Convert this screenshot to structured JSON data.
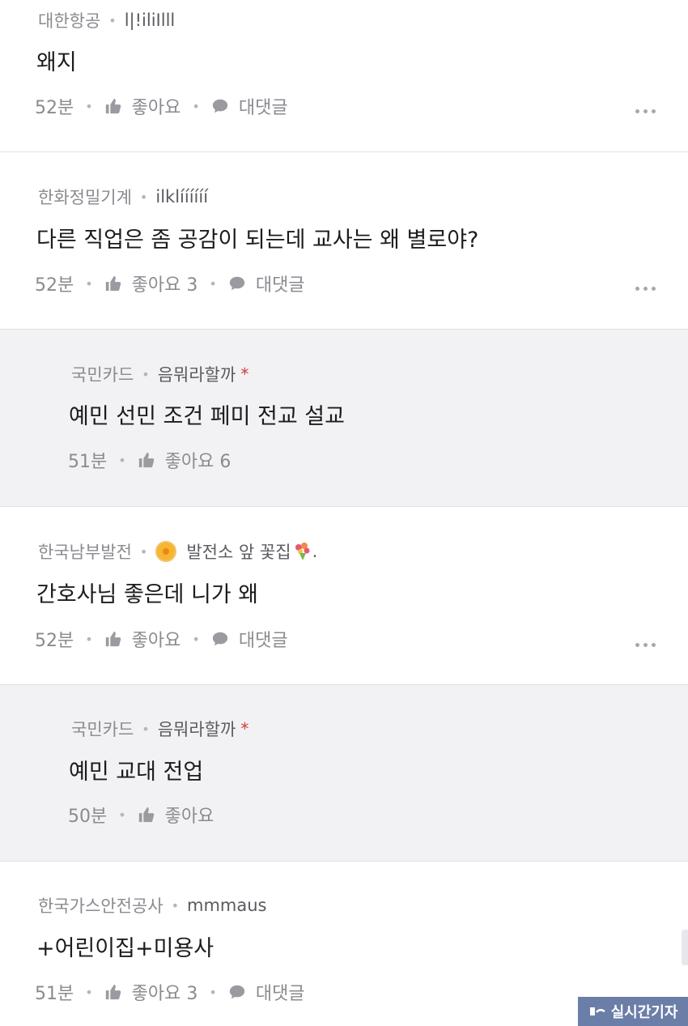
{
  "comments": [
    {
      "company": "대한항공",
      "nickname": "l|!iliIlll",
      "text": "왜지",
      "time": "52분",
      "like_label": "좋아요",
      "reply_label": "대댓글"
    },
    {
      "company": "한화정밀기계",
      "nickname": "ilklíííííí",
      "text": "다른 직업은 좀 공감이 되는데 교사는 왜 별로야?",
      "time": "52분",
      "like_label": "좋아요 3",
      "reply_label": "대댓글"
    },
    {
      "company": "국민카드",
      "nickname": "음뭐라할까",
      "author_mark": "*",
      "text": "예민 선민 조건 페미 전교 설교",
      "time": "51분",
      "like_label": "좋아요 6"
    },
    {
      "company": "한국남부발전",
      "nickname": "발전소 앞 꽃집",
      "nick_suffix": ".",
      "text": "간호사님 좋은데 니가 왜",
      "time": "52분",
      "like_label": "좋아요",
      "reply_label": "대댓글"
    },
    {
      "company": "국민카드",
      "nickname": "음뭐라할까",
      "author_mark": "*",
      "text": "예민 교대 전업",
      "time": "50분",
      "like_label": "좋아요"
    },
    {
      "company": "한국가스안전공사",
      "nickname": "mmmaus",
      "text": "+어린이집+미용사",
      "time": "51분",
      "like_label": "좋아요 3",
      "reply_label": "대댓글"
    }
  ],
  "watermark": "실시간기자",
  "icons": {
    "like": "thumbs-up-icon",
    "reply": "speech-bubble-icon",
    "more": "more-dots-icon",
    "badge": "flower-badge-icon",
    "bouquet": "bouquet-icon"
  },
  "colors": {
    "reply_bg": "#f2f2f4",
    "author_star": "#d23a3a",
    "watermark_bg": "#6b7ea8"
  }
}
